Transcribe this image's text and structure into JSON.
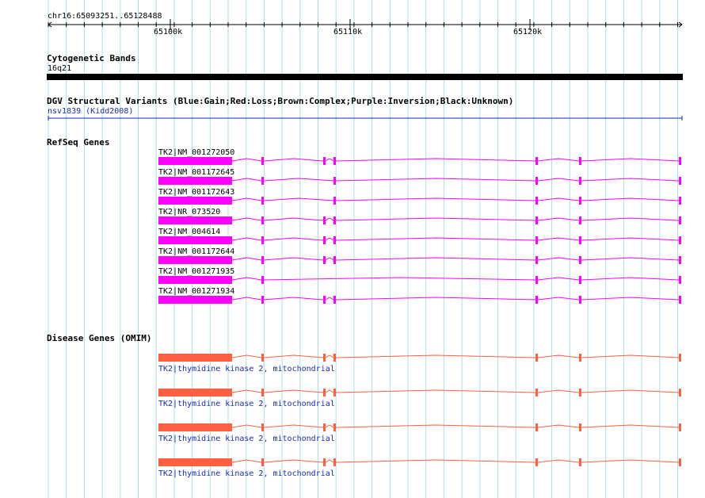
{
  "ruler": {
    "range_label": "chr16:65093251..65128488",
    "ticks": [
      {
        "label": "65100k",
        "position_bp": 65100000
      },
      {
        "label": "65110k",
        "position_bp": 65110000
      },
      {
        "label": "65120k",
        "position_bp": 65120000
      }
    ]
  },
  "tracks": {
    "cytobands": {
      "title": "Cytogenetic Bands",
      "feature_label": "16q21",
      "color": "#000000"
    },
    "dgv": {
      "title": "DGV Structural Variants (Blue:Gain;Red:Loss;Brown:Complex;Purple:Inversion;Black:Unknown)",
      "feature_label": "nsv1839 (Kidd2008)",
      "color": "#1a2bb8"
    },
    "refseq": {
      "title": "RefSeq Genes",
      "color": "#ff00ff",
      "transcripts": [
        {
          "label": "TK2|NM_001272050",
          "variant": "full"
        },
        {
          "label": "TK2|NM_001172645",
          "variant": "no-third-exon"
        },
        {
          "label": "TK2|NM_001172643",
          "variant": "no-third-exon"
        },
        {
          "label": "TK2|NR_073520",
          "variant": "full"
        },
        {
          "label": "TK2|NM_004614",
          "variant": "full"
        },
        {
          "label": "TK2|NM_001172644",
          "variant": "full"
        },
        {
          "label": "TK2|NM_001271935",
          "variant": "no-middle-exons"
        },
        {
          "label": "TK2|NM_001271934",
          "variant": "full"
        }
      ]
    },
    "omim": {
      "title": "Disease Genes (OMIM)",
      "color": "#ff6040",
      "genes": [
        {
          "label": "TK2|thymidine kinase 2, mitochondrial"
        },
        {
          "label": "TK2|thymidine kinase 2, mitochondrial"
        },
        {
          "label": "TK2|thymidine kinase 2, mitochondrial"
        },
        {
          "label": "TK2|thymidine kinase 2, mitochondrial"
        }
      ]
    }
  },
  "colors": {
    "grid": "#a8e0f0",
    "ruler": "#000000"
  }
}
